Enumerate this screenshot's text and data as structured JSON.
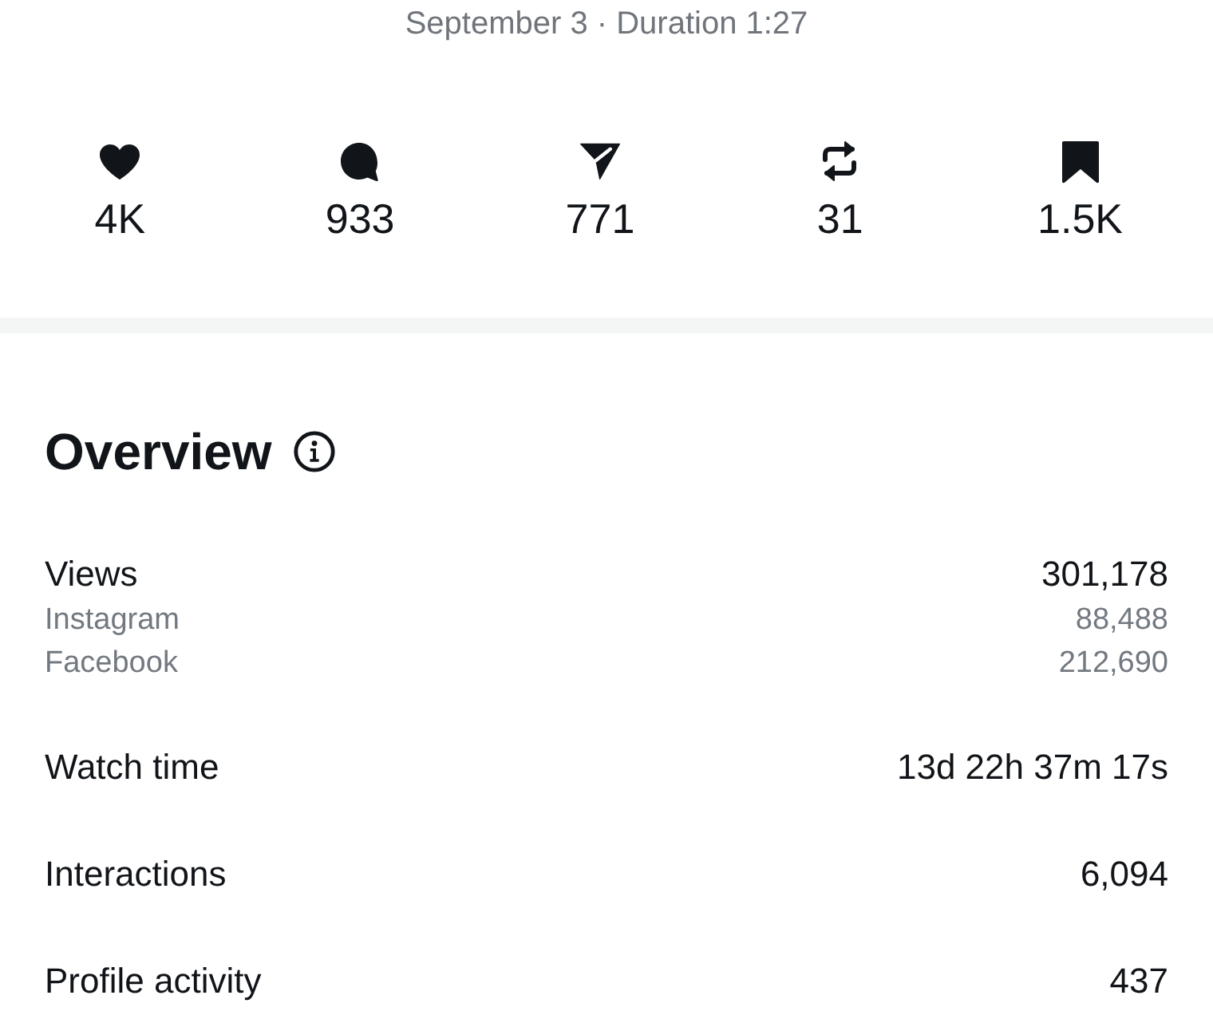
{
  "header": {
    "subtitle": "September 3 · Duration 1:27"
  },
  "stats": [
    {
      "kind": "likes",
      "value": "4K"
    },
    {
      "kind": "comments",
      "value": "933"
    },
    {
      "kind": "shares",
      "value": "771"
    },
    {
      "kind": "reposts",
      "value": "31"
    },
    {
      "kind": "saves",
      "value": "1.5K"
    }
  ],
  "overview": {
    "title": "Overview",
    "rows": [
      {
        "label": "Views",
        "value": "301,178",
        "breakdown": [
          {
            "label": "Instagram",
            "value": "88,488"
          },
          {
            "label": "Facebook",
            "value": "212,690"
          }
        ]
      },
      {
        "label": "Watch time",
        "value": "13d 22h 37m 17s"
      },
      {
        "label": "Interactions",
        "value": "6,094"
      },
      {
        "label": "Profile activity",
        "value": "437"
      }
    ]
  }
}
